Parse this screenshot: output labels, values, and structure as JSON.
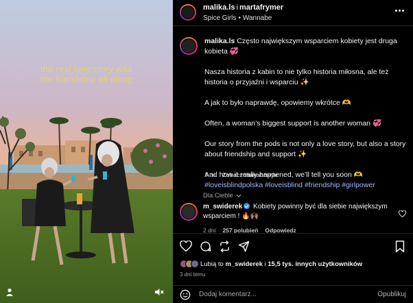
{
  "media": {
    "overlay_lines": [
      "the real love story was",
      "the friendship all along"
    ]
  },
  "header": {
    "author": "malika.ls",
    "connector": "i",
    "coauthor": "martafrymer",
    "audio_artist": "Spice Girls",
    "audio_track": "Wannabe"
  },
  "caption": {
    "username": "malika.ls",
    "p1": "Często największym wsparciem kobiety jest druga kobieta 💞",
    "p2": "Nasza historia z kabin to nie tylko historia miłosna, ale też historia o przyjaźni i wsparciu ✨",
    "p3": "A jak to było naprawdę, opowiemy wkrótce 🫶",
    "p4": "Often, a woman’s biggest support is another woman 💞",
    "p5": "Our story from the pods is not only a love story, but also a story about friendship and support ✨",
    "p6": "And how it really happened, we’ll tell you soon 🫶",
    "hashtags": [
      "#loveisblindpolska",
      "#loveisblind",
      "#friendship",
      "#girlpower"
    ],
    "time": "3 dni",
    "translate": "Zobacz tłumaczenie"
  },
  "for_you": "Dla Ciebie",
  "comment": {
    "username": "m_swiderek",
    "text": "Kobiety powinny być dla siebie największym wsparciem ! 🔥🙌🏽",
    "time": "2 dni",
    "likes": "257 polubień",
    "reply": "Odpowiedz"
  },
  "likes": {
    "prefix": "Lubią to",
    "user": "m_swiderek",
    "middle": "i",
    "others": "15,5 tys. innych użytkowników"
  },
  "posted": "3 dni temu",
  "composer": {
    "placeholder": "Dodaj komentarz...",
    "post_label": "Opublikuj"
  },
  "icons": [
    "user-tag-icon",
    "mute-icon",
    "more-icon",
    "heart-icon",
    "comment-icon",
    "repost-icon",
    "share-icon",
    "bookmark-icon",
    "emoji-icon",
    "chevron-down-icon"
  ]
}
